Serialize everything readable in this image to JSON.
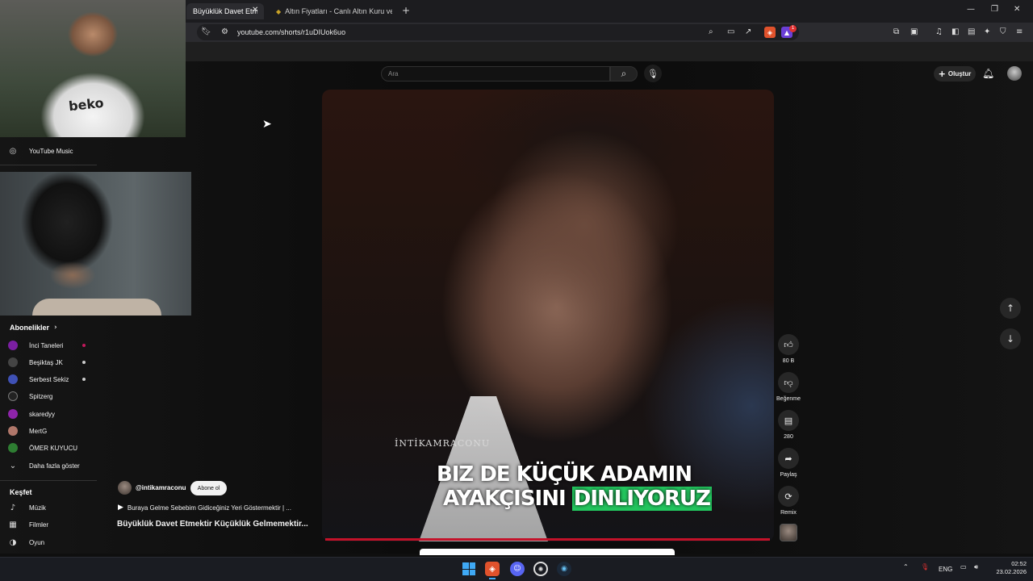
{
  "browser": {
    "tabs": [
      {
        "label": "Büyüklük Davet Etmektir Küçüklük"
      },
      {
        "label": "Altın Fiyatları - Canlı Altın Kuru ve Alt"
      }
    ],
    "url": "youtube.com/shorts/r1uDIUok6uo",
    "extension_badge": "1"
  },
  "youtube": {
    "search_placeholder": "Ara",
    "create_label": "Oluştur",
    "icons": {
      "search": "search-icon",
      "mic": "mic-icon",
      "bell": "bell-icon",
      "plus": "plus-icon"
    }
  },
  "sidebar": {
    "music_label": "YouTube Music",
    "subscriptions_header": "Abonelikler",
    "subscriptions": [
      {
        "label": "İnci Taneleri",
        "color": "#7b1fa2"
      },
      {
        "label": "Beşiktaş JK",
        "color": "#444444"
      },
      {
        "label": "Serbest Sekiz",
        "color": "#3f51b5"
      },
      {
        "label": "Spitzerg",
        "color": "#222222"
      },
      {
        "label": "skaredyy",
        "color": "#8e24aa"
      },
      {
        "label": "MertG",
        "color": "#b0776a"
      },
      {
        "label": "ÖMER KUYUCU",
        "color": "#2e7d32"
      }
    ],
    "show_more_label": "Daha fazla göster",
    "explore_header": "Keşfet",
    "explore": [
      {
        "label": "Müzik"
      },
      {
        "label": "Filmler"
      },
      {
        "label": "Oyun"
      }
    ]
  },
  "video": {
    "watermark": "İNTİKAMRACONU",
    "subtitle_line1": "BIZ DE KÜÇÜK ADAMIN",
    "subtitle_line2_plain": "AYAKÇISINI",
    "subtitle_line2_highlight": "DINLIYORUZ",
    "highlight_color": "#22c55e"
  },
  "actions": {
    "like_count": "80 B",
    "dislike_label": "Beğenme",
    "comment_count": "280",
    "share_label": "Paylaş",
    "remix_label": "Remix"
  },
  "channel": {
    "handle": "@intikamraconu",
    "subscribe_label": "Abone ol",
    "description": "Buraya Gelme Sebebim Gidiceğiniz Yeri Göstermektir | ...",
    "title": "Büyüklük Davet Etmektir Küçüklük Gelmemektir..."
  },
  "webcam": {
    "jersey_logo": "beko"
  },
  "taskbar": {
    "language": "ENG",
    "time": "02:52",
    "date": "23.02.2026"
  }
}
